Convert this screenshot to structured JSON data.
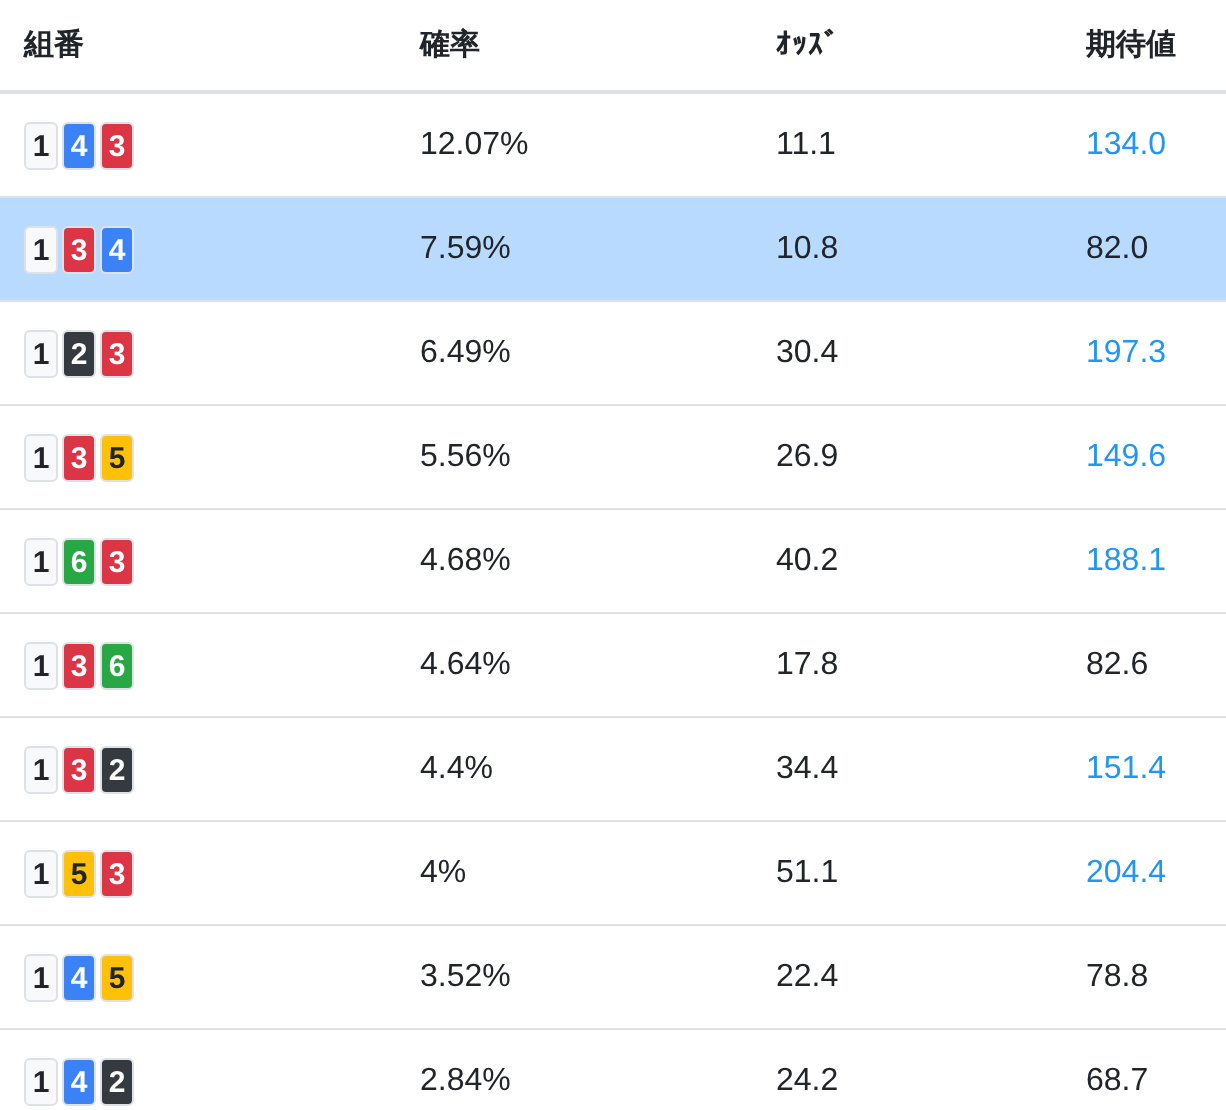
{
  "table": {
    "columns": [
      "組番",
      "確率",
      "ｵｯｽﾞ",
      "期待値"
    ],
    "rows": [
      {
        "selected": false,
        "combo": [
          {
            "text": "1",
            "color": "#f8f9fa"
          },
          {
            "text": "4",
            "color": "#3b82f6"
          },
          {
            "text": "3",
            "color": "#dc3545"
          }
        ],
        "probability": "12.07%",
        "odds": "11.1",
        "expected": "134.0",
        "highlight": true
      },
      {
        "selected": true,
        "combo": [
          {
            "text": "1",
            "color": "#f8f9fa"
          },
          {
            "text": "3",
            "color": "#dc3545"
          },
          {
            "text": "4",
            "color": "#3b82f6"
          }
        ],
        "probability": "7.59%",
        "odds": "10.8",
        "expected": "82.0",
        "highlight": false
      },
      {
        "selected": false,
        "combo": [
          {
            "text": "1",
            "color": "#f8f9fa"
          },
          {
            "text": "2",
            "color": "#343a40"
          },
          {
            "text": "3",
            "color": "#dc3545"
          }
        ],
        "probability": "6.49%",
        "odds": "30.4",
        "expected": "197.3",
        "highlight": true
      },
      {
        "selected": false,
        "combo": [
          {
            "text": "1",
            "color": "#f8f9fa"
          },
          {
            "text": "3",
            "color": "#dc3545"
          },
          {
            "text": "5",
            "color": "#ffc107"
          }
        ],
        "probability": "5.56%",
        "odds": "26.9",
        "expected": "149.6",
        "highlight": true
      },
      {
        "selected": false,
        "combo": [
          {
            "text": "1",
            "color": "#f8f9fa"
          },
          {
            "text": "6",
            "color": "#28a745"
          },
          {
            "text": "3",
            "color": "#dc3545"
          }
        ],
        "probability": "4.68%",
        "odds": "40.2",
        "expected": "188.1",
        "highlight": true
      },
      {
        "selected": false,
        "combo": [
          {
            "text": "1",
            "color": "#f8f9fa"
          },
          {
            "text": "3",
            "color": "#dc3545"
          },
          {
            "text": "6",
            "color": "#28a745"
          }
        ],
        "probability": "4.64%",
        "odds": "17.8",
        "expected": "82.6",
        "highlight": false
      },
      {
        "selected": false,
        "combo": [
          {
            "text": "1",
            "color": "#f8f9fa"
          },
          {
            "text": "3",
            "color": "#dc3545"
          },
          {
            "text": "2",
            "color": "#343a40"
          }
        ],
        "probability": "4.4%",
        "odds": "34.4",
        "expected": "151.4",
        "highlight": true
      },
      {
        "selected": false,
        "combo": [
          {
            "text": "1",
            "color": "#f8f9fa"
          },
          {
            "text": "5",
            "color": "#ffc107"
          },
          {
            "text": "3",
            "color": "#dc3545"
          }
        ],
        "probability": "4%",
        "odds": "51.1",
        "expected": "204.4",
        "highlight": true
      },
      {
        "selected": false,
        "combo": [
          {
            "text": "1",
            "color": "#f8f9fa"
          },
          {
            "text": "4",
            "color": "#3b82f6"
          },
          {
            "text": "5",
            "color": "#ffc107"
          }
        ],
        "probability": "3.52%",
        "odds": "22.4",
        "expected": "78.8",
        "highlight": false
      },
      {
        "selected": false,
        "combo": [
          {
            "text": "1",
            "color": "#f8f9fa"
          },
          {
            "text": "4",
            "color": "#3b82f6"
          },
          {
            "text": "2",
            "color": "#343a40"
          }
        ],
        "probability": "2.84%",
        "odds": "24.2",
        "expected": "68.7",
        "highlight": false
      }
    ]
  }
}
